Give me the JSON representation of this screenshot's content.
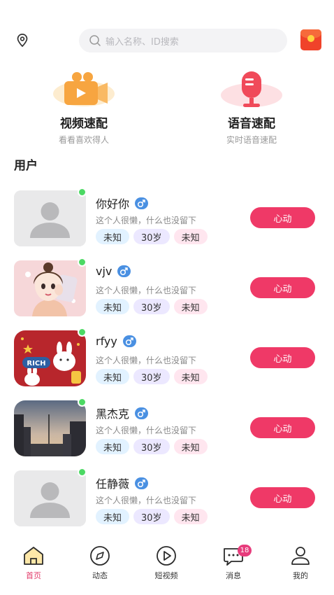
{
  "header": {
    "location_icon": "location-pin-icon",
    "search_placeholder": "输入名称、ID搜索",
    "red_packet_icon": "red-packet-icon"
  },
  "quick_match": {
    "video": {
      "title": "视频速配",
      "subtitle": "看看喜欢得人",
      "icon": "video-camera-icon"
    },
    "voice": {
      "title": "语音速配",
      "subtitle": "实时语音速配",
      "icon": "microphone-icon"
    }
  },
  "users_section_title": "用户",
  "users": [
    {
      "name": "你好你",
      "bio": "这个人很懒，什么也没留下",
      "tags": [
        "未知",
        "30岁",
        "未知"
      ],
      "button": "心动",
      "online": true,
      "gender": "male"
    },
    {
      "name": "vjv",
      "bio": "这个人很懒，什么也没留下",
      "tags": [
        "未知",
        "30岁",
        "未知"
      ],
      "button": "心动",
      "online": true,
      "gender": "male"
    },
    {
      "name": "rfyy",
      "bio": "这个人很懒，什么也没留下",
      "tags": [
        "未知",
        "30岁",
        "未知"
      ],
      "button": "心动",
      "online": true,
      "gender": "male"
    },
    {
      "name": "黑杰克",
      "bio": "这个人很懒，什么也没留下",
      "tags": [
        "未知",
        "30岁",
        "未知"
      ],
      "button": "心动",
      "online": true,
      "gender": "male"
    },
    {
      "name": "任静薇",
      "bio": "这个人很懒，什么也没留下",
      "tags": [
        "未知",
        "30岁",
        "未知"
      ],
      "button": "心动",
      "online": true,
      "gender": "male"
    }
  ],
  "avatar_text": {
    "rich": "RICH"
  },
  "tabbar": {
    "items": [
      {
        "label": "首页",
        "icon": "home-icon",
        "active": true
      },
      {
        "label": "动态",
        "icon": "compass-icon",
        "active": false
      },
      {
        "label": "短视频",
        "icon": "play-circle-icon",
        "active": false
      },
      {
        "label": "消息",
        "icon": "chat-bubble-icon",
        "active": false,
        "badge": "18"
      },
      {
        "label": "我的",
        "icon": "profile-icon",
        "active": false
      }
    ]
  },
  "colors": {
    "accent": "#ef3967",
    "online": "#4cd964",
    "gender_male": "#4a90e2",
    "tab_active": "#e23b6a"
  }
}
